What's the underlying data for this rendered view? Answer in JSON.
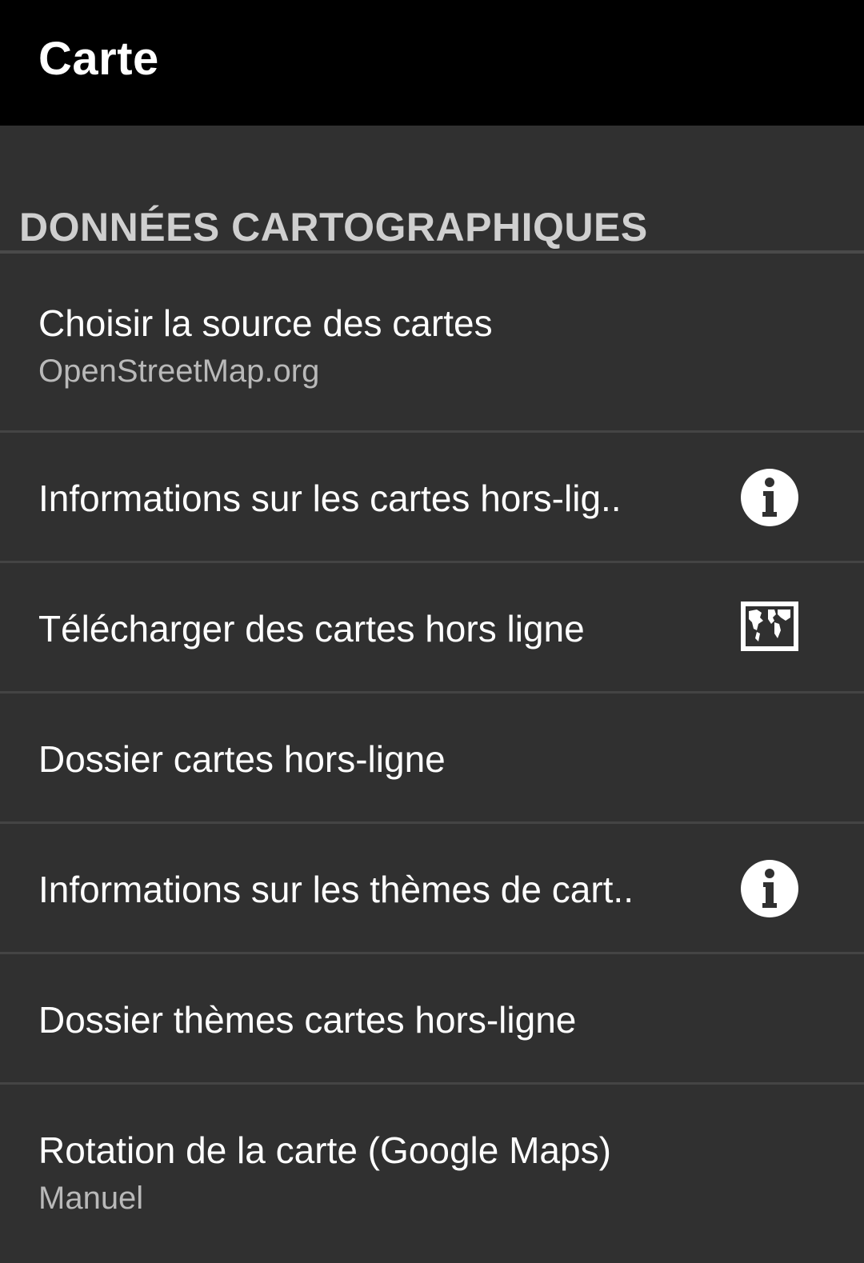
{
  "app_bar": {
    "title": "Carte"
  },
  "section": {
    "header": "DONNÉES CARTOGRAPHIQUES"
  },
  "rows": [
    {
      "title": "Choisir la source des cartes",
      "subtitle": "OpenStreetMap.org",
      "icon": ""
    },
    {
      "title": "Informations sur les cartes hors-lig..",
      "subtitle": "",
      "icon": "info-icon"
    },
    {
      "title": "Télécharger des cartes hors ligne",
      "subtitle": "",
      "icon": "world-map-icon"
    },
    {
      "title": "Dossier cartes hors-ligne",
      "subtitle": "",
      "icon": ""
    },
    {
      "title": "Informations sur les thèmes de cart..",
      "subtitle": "",
      "icon": "info-icon"
    },
    {
      "title": "Dossier thèmes cartes hors-ligne",
      "subtitle": "",
      "icon": ""
    },
    {
      "title": "Rotation de la carte (Google Maps)",
      "subtitle": "Manuel",
      "icon": ""
    }
  ],
  "colors": {
    "app_bar_bg": "#000000",
    "page_bg": "#303030",
    "divider": "#444444",
    "section_text": "#cfcfcf",
    "secondary_text": "#b9b9b9"
  }
}
